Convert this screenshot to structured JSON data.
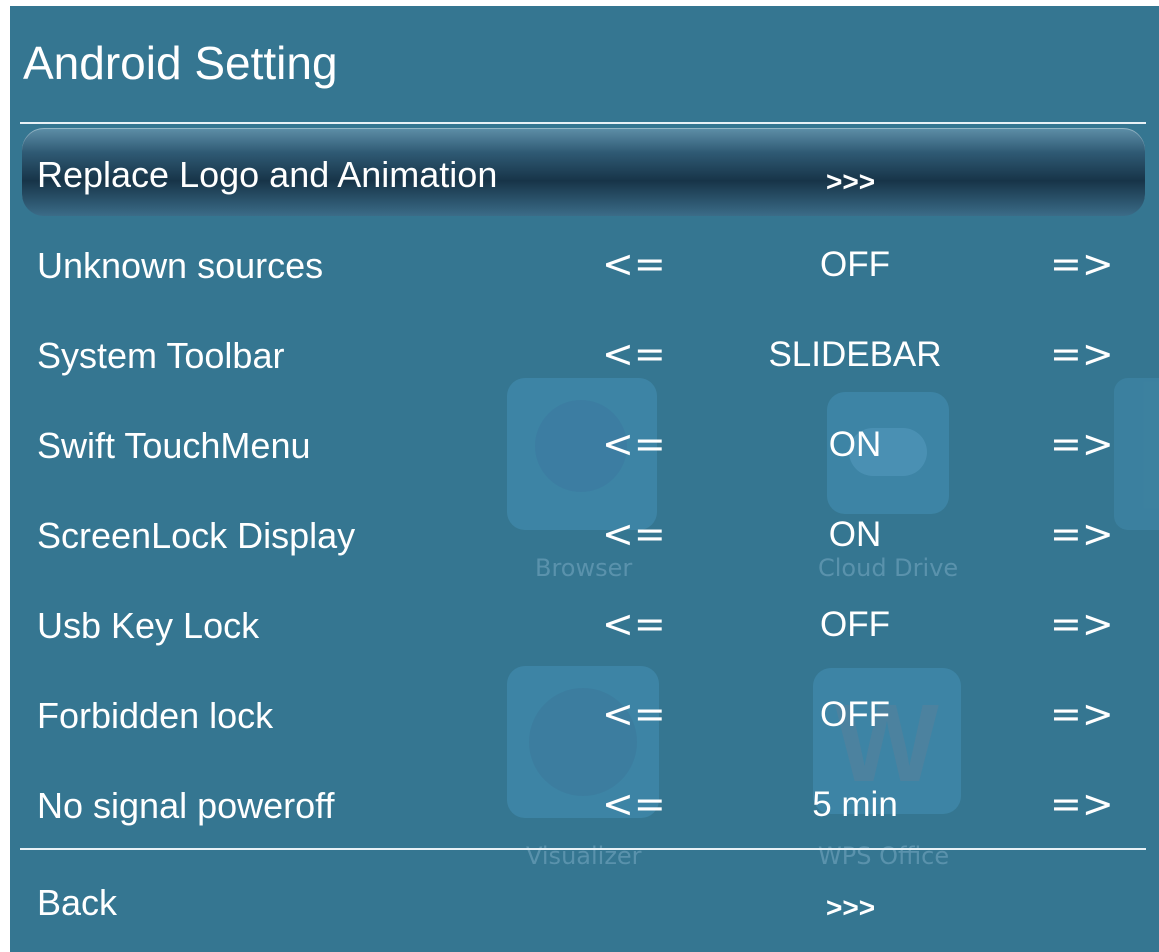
{
  "screen": {
    "title": "Android Setting"
  },
  "background_apps": [
    {
      "label": "Browser",
      "icon": "globe-icon"
    },
    {
      "label": "Cloud Drive",
      "icon": "cloud-icon"
    },
    {
      "label": "Visualizer",
      "icon": "disc-icon"
    },
    {
      "label": "WPS Office",
      "icon": "wps-icon"
    }
  ],
  "menu": {
    "replace_logo": {
      "label": "Replace Logo and Animation",
      "action": ">>>"
    },
    "settings": [
      {
        "label": "Unknown sources",
        "prev": "<=",
        "value": "OFF",
        "next": "=>"
      },
      {
        "label": "System Toolbar",
        "prev": "<=",
        "value": "SLIDEBAR",
        "next": "=>"
      },
      {
        "label": "Swift TouchMenu",
        "prev": "<=",
        "value": "ON",
        "next": "=>"
      },
      {
        "label": "ScreenLock Display",
        "prev": "<=",
        "value": "ON",
        "next": "=>"
      },
      {
        "label": "Usb Key Lock",
        "prev": "<=",
        "value": "OFF",
        "next": "=>"
      },
      {
        "label": "Forbidden lock",
        "prev": "<=",
        "value": "OFF",
        "next": "=>"
      },
      {
        "label": "No signal poweroff",
        "prev": "<=",
        "value": "5 min",
        "next": "=>"
      }
    ],
    "back": {
      "label": "Back",
      "action": ">>>"
    }
  },
  "colors": {
    "panel_background": "#357691",
    "highlight_bar": "#173448",
    "text": "#ffffff",
    "divider": "#e8f1f6"
  }
}
